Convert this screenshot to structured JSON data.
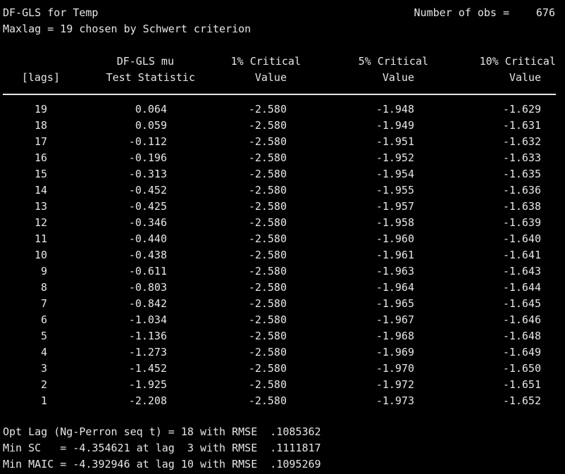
{
  "header": {
    "title": "DF-GLS for Temp",
    "obs_label": "Number of obs =",
    "obs_value": "676",
    "maxlag_line": "Maxlag = 19 chosen by Schwert criterion"
  },
  "columns": {
    "lags_header": "[lags]",
    "stat_header_1": "DF-GLS mu",
    "stat_header_2": "Test Statistic",
    "c1_header_1": "1% Critical",
    "c1_header_2": "Value",
    "c5_header_1": "5% Critical",
    "c5_header_2": "Value",
    "c10_header_1": "10% Critical",
    "c10_header_2": "Value"
  },
  "rows": [
    {
      "lag": "19",
      "stat": "0.064",
      "c1": "-2.580",
      "c5": "-1.948",
      "c10": "-1.629"
    },
    {
      "lag": "18",
      "stat": "0.059",
      "c1": "-2.580",
      "c5": "-1.949",
      "c10": "-1.631"
    },
    {
      "lag": "17",
      "stat": "-0.112",
      "c1": "-2.580",
      "c5": "-1.951",
      "c10": "-1.632"
    },
    {
      "lag": "16",
      "stat": "-0.196",
      "c1": "-2.580",
      "c5": "-1.952",
      "c10": "-1.633"
    },
    {
      "lag": "15",
      "stat": "-0.313",
      "c1": "-2.580",
      "c5": "-1.954",
      "c10": "-1.635"
    },
    {
      "lag": "14",
      "stat": "-0.452",
      "c1": "-2.580",
      "c5": "-1.955",
      "c10": "-1.636"
    },
    {
      "lag": "13",
      "stat": "-0.425",
      "c1": "-2.580",
      "c5": "-1.957",
      "c10": "-1.638"
    },
    {
      "lag": "12",
      "stat": "-0.346",
      "c1": "-2.580",
      "c5": "-1.958",
      "c10": "-1.639"
    },
    {
      "lag": "11",
      "stat": "-0.440",
      "c1": "-2.580",
      "c5": "-1.960",
      "c10": "-1.640"
    },
    {
      "lag": "10",
      "stat": "-0.438",
      "c1": "-2.580",
      "c5": "-1.961",
      "c10": "-1.641"
    },
    {
      "lag": "9",
      "stat": "-0.611",
      "c1": "-2.580",
      "c5": "-1.963",
      "c10": "-1.643"
    },
    {
      "lag": "8",
      "stat": "-0.803",
      "c1": "-2.580",
      "c5": "-1.964",
      "c10": "-1.644"
    },
    {
      "lag": "7",
      "stat": "-0.842",
      "c1": "-2.580",
      "c5": "-1.965",
      "c10": "-1.645"
    },
    {
      "lag": "6",
      "stat": "-1.034",
      "c1": "-2.580",
      "c5": "-1.967",
      "c10": "-1.646"
    },
    {
      "lag": "5",
      "stat": "-1.136",
      "c1": "-2.580",
      "c5": "-1.968",
      "c10": "-1.648"
    },
    {
      "lag": "4",
      "stat": "-1.273",
      "c1": "-2.580",
      "c5": "-1.969",
      "c10": "-1.649"
    },
    {
      "lag": "3",
      "stat": "-1.452",
      "c1": "-2.580",
      "c5": "-1.970",
      "c10": "-1.650"
    },
    {
      "lag": "2",
      "stat": "-1.925",
      "c1": "-2.580",
      "c5": "-1.972",
      "c10": "-1.651"
    },
    {
      "lag": "1",
      "stat": "-2.208",
      "c1": "-2.580",
      "c5": "-1.973",
      "c10": "-1.652"
    }
  ],
  "footer": {
    "opt_lag": "Opt Lag (Ng-Perron seq t) = 18 with RMSE  .1085362",
    "min_sc": "Min SC   = -4.354621 at lag  3 with RMSE  .1111817",
    "min_maic": "Min MAIC = -4.392946 at lag 10 with RMSE  .1095269"
  },
  "colors": {
    "background": "#000000",
    "text": "#e6e6e6"
  }
}
